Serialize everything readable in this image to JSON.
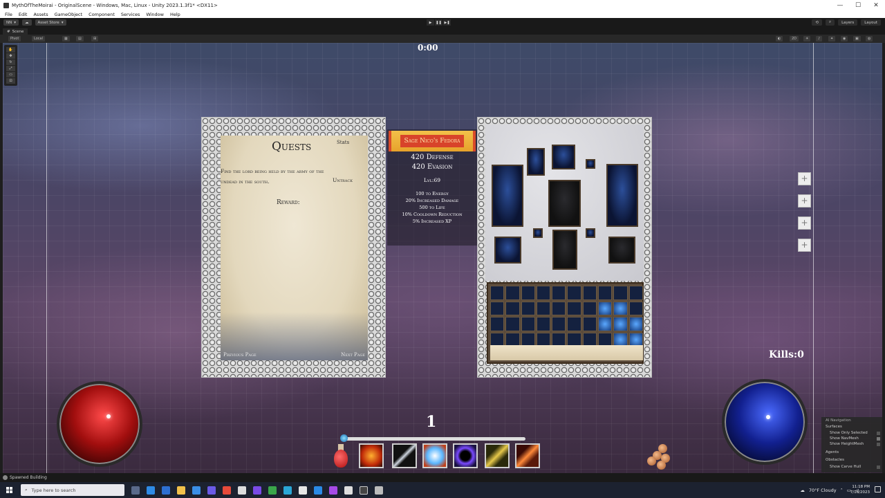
{
  "window": {
    "title": "MythOfTheMoirai - OriginalScene - Windows, Mac, Linux - Unity 2023.1.3f1* <DX11>",
    "minimize": "—",
    "maximize": "☐",
    "close": "✕"
  },
  "menu": [
    "File",
    "Edit",
    "Assets",
    "GameObject",
    "Component",
    "Services",
    "Window",
    "Help"
  ],
  "toolbar": {
    "account": "NN",
    "asset_store": "Asset Store",
    "play": "▶",
    "pause": "❚❚",
    "step": "▶❚",
    "layers": "Layers",
    "layout": "Layout"
  },
  "scene": {
    "tab_label": "Scene",
    "pivot": "Pivot",
    "local": "Local",
    "view_2d": "2D"
  },
  "hud": {
    "timer": "0:00",
    "kills": "Kills:0",
    "level": "1",
    "xp_fill": 1.0
  },
  "quests": {
    "title": "Quests",
    "stats_tab": "Stats",
    "description": "Find the lord being held by the army of the undead in the south.",
    "untrack": "Untrack",
    "reward": "Reward:",
    "prev_page": "Previous Page",
    "next_page": "Next Page"
  },
  "item": {
    "name": "Sage Nico's Fedora",
    "defense": "420 Defense",
    "evasion": "420 Evasion",
    "level": "Lvl:69",
    "mods": [
      "100 to Energy",
      "20% Increased Damage",
      "500 to Life",
      "10% Cooldown Reduction",
      "5% Increased XP"
    ]
  },
  "side_buttons": [
    "+",
    "+",
    "+",
    "+"
  ],
  "ai_navigation": {
    "title": "AI Navigation",
    "surfaces": "Surfaces",
    "show_only_selected": "Show Only Selected",
    "show_navmesh": "Show NavMesh",
    "show_heightmesh": "Show HeightMesh",
    "agents": "Agents",
    "obstacles": "Obstacles",
    "show_carve_hull": "Show Carve Hull"
  },
  "status": {
    "message": "Spawned Building"
  },
  "taskbar": {
    "search_placeholder": "Type here to search",
    "weather": "70°F  Cloudy",
    "time": "11:18 PM",
    "date": "7/16/2023"
  },
  "colors": {
    "health_orb": "#a10e0e",
    "mana_orb": "#12208f",
    "banner_red": "#d8432a",
    "banner_gold": "#f2c14a"
  }
}
